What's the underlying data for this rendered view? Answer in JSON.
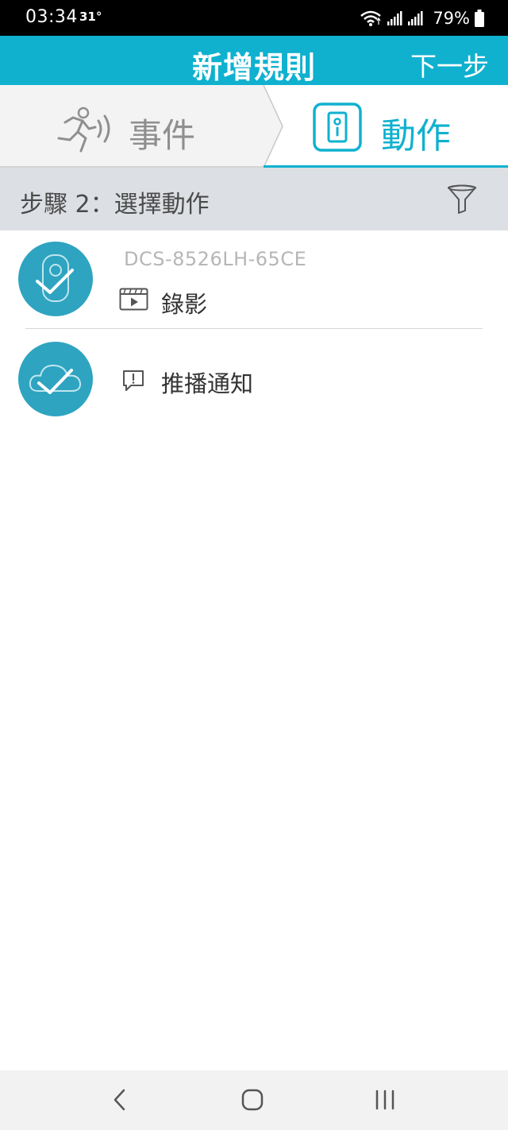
{
  "status_bar": {
    "time": "03:34",
    "temperature": "31°",
    "battery": "79%"
  },
  "header": {
    "title": "新增規則",
    "next_label": "下一步"
  },
  "tabs": {
    "event_label": "事件",
    "action_label": "動作",
    "active_tab": "action"
  },
  "step": {
    "title": "步驟 2：選擇動作"
  },
  "actions": [
    {
      "device": "DCS-8526LH-65CE",
      "label": "錄影",
      "icon": "video-record-icon",
      "checked": true
    },
    {
      "device": "",
      "label": "推播通知",
      "icon": "notification-icon",
      "checked": true
    }
  ],
  "colors": {
    "accent": "#0fb1cf",
    "item_circle": "#2ea4c1",
    "step_bg": "#dcdfe3",
    "inactive_tab_bg": "#f3f3f3",
    "nav_bg": "#f2f2f2"
  },
  "icons": {
    "wifi": "wifi-icon",
    "signal": "signal-icon",
    "battery": "battery-icon",
    "event": "running-person-icon",
    "action": "device-icon",
    "filter": "filter-icon",
    "camera": "camera-check-icon",
    "cloud": "cloud-check-icon",
    "back": "back-icon",
    "home": "home-icon",
    "recents": "recents-icon"
  }
}
